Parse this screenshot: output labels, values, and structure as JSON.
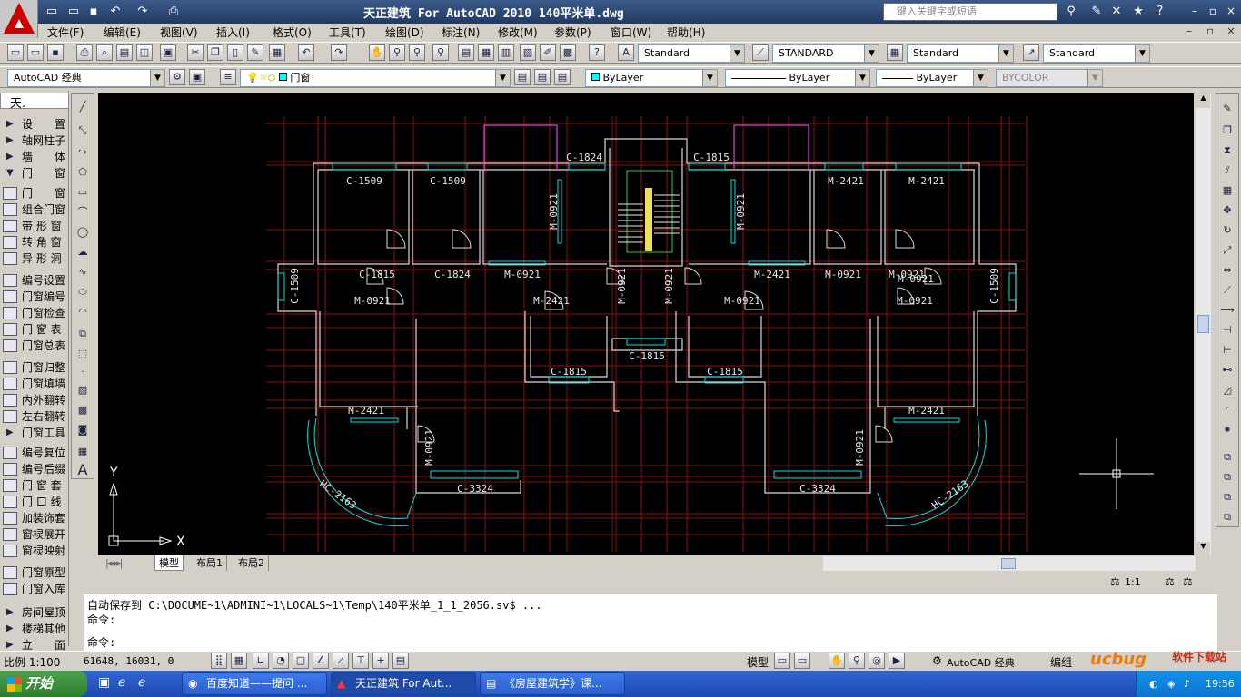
{
  "window": {
    "title": "天正建筑 For AutoCAD 2010  140平米单.dwg",
    "search_placeholder": "键入关键字或短语"
  },
  "menu": [
    "文件(F)",
    "编辑(E)",
    "视图(V)",
    "插入(I)",
    "格式(O)",
    "工具(T)",
    "绘图(D)",
    "标注(N)",
    "修改(M)",
    "参数(P)",
    "窗口(W)",
    "帮助(H)"
  ],
  "styles": {
    "text_style": "Standard",
    "dim_style": "STANDARD",
    "table_style": "Standard",
    "multileader_style": "Standard"
  },
  "workspace": "AutoCAD 经典",
  "layer": "门窗",
  "properties": {
    "color": "ByLayer",
    "linetype": "ByLayer",
    "lineweight": "ByLayer",
    "plotstyle": "BYCOLOR"
  },
  "tianzheng_panel": {
    "title": "天.",
    "items": [
      {
        "label": "设　　置",
        "kind": "arrow"
      },
      {
        "label": "轴网柱子",
        "kind": "arrow"
      },
      {
        "label": "墙　　体",
        "kind": "arrow"
      },
      {
        "label": "门　　窗",
        "kind": "open"
      },
      {
        "label": "门　　窗",
        "kind": "icon"
      },
      {
        "label": "组合门窗",
        "kind": "icon"
      },
      {
        "label": "带 形 窗",
        "kind": "icon"
      },
      {
        "label": "转 角 窗",
        "kind": "icon"
      },
      {
        "label": "异 形 洞",
        "kind": "icon"
      },
      {
        "label": "编号设置",
        "kind": "icon"
      },
      {
        "label": "门窗编号",
        "kind": "icon"
      },
      {
        "label": "门窗检查",
        "kind": "icon"
      },
      {
        "label": "门 窗 表",
        "kind": "icon"
      },
      {
        "label": "门窗总表",
        "kind": "icon"
      },
      {
        "label": "门窗归整",
        "kind": "icon"
      },
      {
        "label": "门窗填墙",
        "kind": "icon"
      },
      {
        "label": "内外翻转",
        "kind": "icon"
      },
      {
        "label": "左右翻转",
        "kind": "icon"
      },
      {
        "label": "门窗工具",
        "kind": "arrow"
      },
      {
        "label": "编号复位",
        "kind": "icon"
      },
      {
        "label": "编号后缀",
        "kind": "icon"
      },
      {
        "label": "门 窗 套",
        "kind": "icon"
      },
      {
        "label": "门 口 线",
        "kind": "icon"
      },
      {
        "label": "加装饰套",
        "kind": "icon"
      },
      {
        "label": "窗棂展开",
        "kind": "icon"
      },
      {
        "label": "窗棂映射",
        "kind": "icon"
      },
      {
        "label": "门窗原型",
        "kind": "icon"
      },
      {
        "label": "门窗入库",
        "kind": "icon"
      },
      {
        "label": "房间屋顶",
        "kind": "arrow"
      },
      {
        "label": "楼梯其他",
        "kind": "arrow"
      },
      {
        "label": "立　　面",
        "kind": "arrow"
      }
    ]
  },
  "drawing": {
    "labels": [
      "C-1509",
      "C-1509",
      "C-1824",
      "C-1815",
      "M-2421",
      "M-2421",
      "C-1815",
      "C-1824",
      "M-0921",
      "M-0921",
      "M-2421",
      "M-0921",
      "M-0921",
      "M-2421",
      "M-0921",
      "M-0921",
      "C-1509",
      "C-1509",
      "M-0921",
      "M-0921",
      "M-0921",
      "M-0921",
      "M-0921",
      "C-1815",
      "C-1815",
      "C-1815",
      "M-2421",
      "M-2421",
      "M-0921",
      "M-0921",
      "C-3324",
      "C-3324",
      "HC-2163",
      "HC-2163"
    ],
    "ucs_x": "X",
    "ucs_y": "Y"
  },
  "layout_tabs": [
    "模型",
    "布局1",
    "布局2"
  ],
  "annotation_scale": "1:1",
  "command_lines": [
    "自动保存到 C:\\DOCUME~1\\ADMINI~1\\LOCALS~1\\Temp\\140平米单_1_1_2056.sv$ ...",
    "命令:",
    "命令:"
  ],
  "status": {
    "scale": "比例 1:100",
    "coords": "61648, 16031, 0",
    "model": "模型",
    "workspace": "AutoCAD 经典",
    "group": "编组"
  },
  "taskbar": {
    "start": "开始",
    "tasks": [
      "百度知道——提问 ...",
      "天正建筑 For Aut...",
      "《房屋建筑学》课..."
    ],
    "clock": "19:56"
  },
  "watermark": "软件下载站"
}
